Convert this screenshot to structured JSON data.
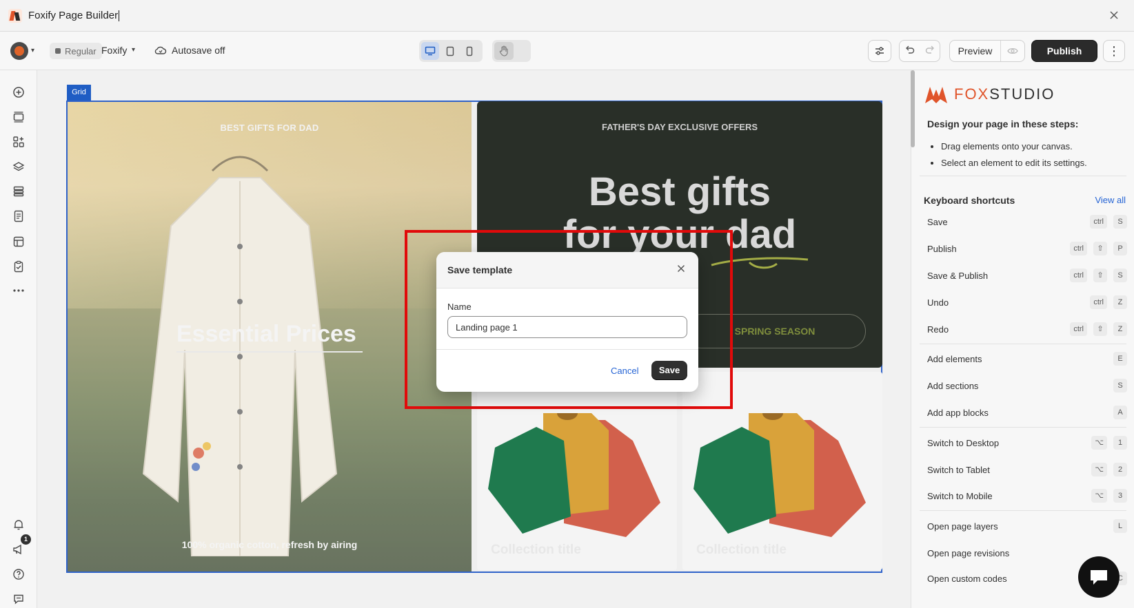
{
  "window": {
    "title": "Foxify Page Builder"
  },
  "toolbar": {
    "plan_badge": "Regular",
    "store_name": "Foxify",
    "autosave_label": "Autosave off",
    "preview_label": "Preview",
    "publish_label": "Publish",
    "more_label": "⋮"
  },
  "canvas": {
    "grid_tag": "Grid",
    "hero": {
      "kicker": "BEST GIFTS FOR DAD",
      "title": "Essential Prices",
      "caption": "100% organic cotton, refresh by airing"
    },
    "promo": {
      "kicker": "FATHER'S DAY EXCLUSIVE OFFERS",
      "title_line1": "Best gifts",
      "title_line2": "for your dad",
      "cta": "SPRING SEASON"
    },
    "collections": [
      {
        "title": "Collection title"
      },
      {
        "title": "Collection title"
      }
    ]
  },
  "modal": {
    "title": "Save template",
    "name_label": "Name",
    "name_value": "Landing page 1",
    "cancel_label": "Cancel",
    "save_label": "Save"
  },
  "panel": {
    "brand": {
      "word_fox": "FOX",
      "word_studio": "STUDIO"
    },
    "steps_title": "Design your page in these steps:",
    "steps": [
      "Drag elements onto your canvas.",
      "Select an element to edit its settings."
    ],
    "shortcuts_title": "Keyboard shortcuts",
    "view_all": "View all",
    "shortcuts": [
      {
        "label": "Save",
        "keys": [
          "ctrl",
          "S"
        ]
      },
      {
        "label": "Publish",
        "keys": [
          "ctrl",
          "⇧",
          "P"
        ]
      },
      {
        "label": "Save & Publish",
        "keys": [
          "ctrl",
          "⇧",
          "S"
        ]
      },
      {
        "label": "Undo",
        "keys": [
          "ctrl",
          "Z"
        ]
      },
      {
        "label": "Redo",
        "keys": [
          "ctrl",
          "⇧",
          "Z"
        ]
      },
      {
        "label": "Add elements",
        "keys": [
          "E"
        ]
      },
      {
        "label": "Add sections",
        "keys": [
          "S"
        ]
      },
      {
        "label": "Add app blocks",
        "keys": [
          "A"
        ]
      },
      {
        "label": "Switch to Desktop",
        "keys": [
          "⌥",
          "1"
        ]
      },
      {
        "label": "Switch to Tablet",
        "keys": [
          "⌥",
          "2"
        ]
      },
      {
        "label": "Switch to Mobile",
        "keys": [
          "⌥",
          "3"
        ]
      },
      {
        "label": "Open page layers",
        "keys": [
          "L"
        ]
      },
      {
        "label": "Open page revisions",
        "keys": []
      },
      {
        "label": "Open custom codes",
        "keys": [
          "C"
        ]
      }
    ]
  },
  "notifications": {
    "badge_count": "1"
  },
  "colors": {
    "accent": "#2463d4",
    "primary_button": "#303030",
    "highlight": "#e10a0a",
    "brand_orange": "#e0542a",
    "promo_bg": "#292f28"
  }
}
